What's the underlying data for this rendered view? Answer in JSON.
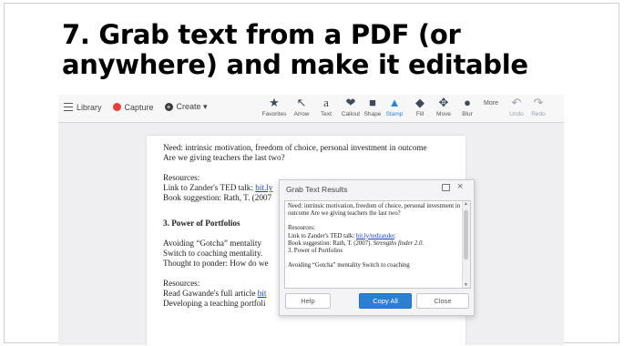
{
  "slide": {
    "title_line1": "7. Grab text from a PDF (or",
    "title_line2": "anywhere) and make it editable"
  },
  "toolbar": {
    "library": "Library",
    "capture": "Capture",
    "create": "Create ▾",
    "tools": [
      {
        "label": "Favorites",
        "icon": "star-icon"
      },
      {
        "label": "Arrow",
        "icon": "arrow-icon"
      },
      {
        "label": "Text",
        "icon": "text-icon"
      },
      {
        "label": "Callout",
        "icon": "callout-icon"
      },
      {
        "label": "Shape",
        "icon": "shape-icon"
      },
      {
        "label": "Stamp",
        "icon": "stamp-icon"
      },
      {
        "label": "Fill",
        "icon": "fill-icon"
      },
      {
        "label": "Move",
        "icon": "move-icon"
      },
      {
        "label": "Blur",
        "icon": "blur-icon"
      },
      {
        "label": "More",
        "icon": "more-icon"
      },
      {
        "label": "Undo",
        "icon": "undo-icon"
      },
      {
        "label": "Redo",
        "icon": "redo-icon"
      }
    ],
    "active_tool": "Stamp",
    "accent": "#2f86d8"
  },
  "document": {
    "line1": "Need: intrinsic motivation, freedom of choice, personal investment in outcome",
    "line2": "Are we giving teachers the last two?",
    "resources1": "Resources:",
    "ted_prefix": "Link to Zander's TED talk: ",
    "ted_link": "bit.ly",
    "book": "Book suggestion: Rath, T. (2007",
    "heading": "3.   Power of Portfolios",
    "avoid": "Avoiding “Gotcha” mentality",
    "coach": "Switch to coaching mentality.",
    "ponder": "Thought to ponder: How do we",
    "resources2": "Resources:",
    "gawande_prefix": "Read Gawande's full article ",
    "gawande_link": "bit",
    "developing": "Developing a teaching portfoli"
  },
  "dialog": {
    "title": "Grab Text Results",
    "text1": "Need: intrinsic motivation, freedom of choice, personal investment in outcome Are we giving teachers the last two?",
    "resources": "Resources:",
    "ted_prefix": "Link to Zander's TED talk: ",
    "ted_link": "bit.ly/tedzander",
    "ted_suffix": ".",
    "book_prefix": "Book suggestion: Rath, T. (2007). ",
    "book_title": "Strengths finder 2.0.",
    "portfolios": "3. Power of Portfolios",
    "avoid": "Avoiding “Gotcha” mentality Switch to coaching",
    "help": "Help",
    "copy_all": "Copy All",
    "close": "Close"
  }
}
